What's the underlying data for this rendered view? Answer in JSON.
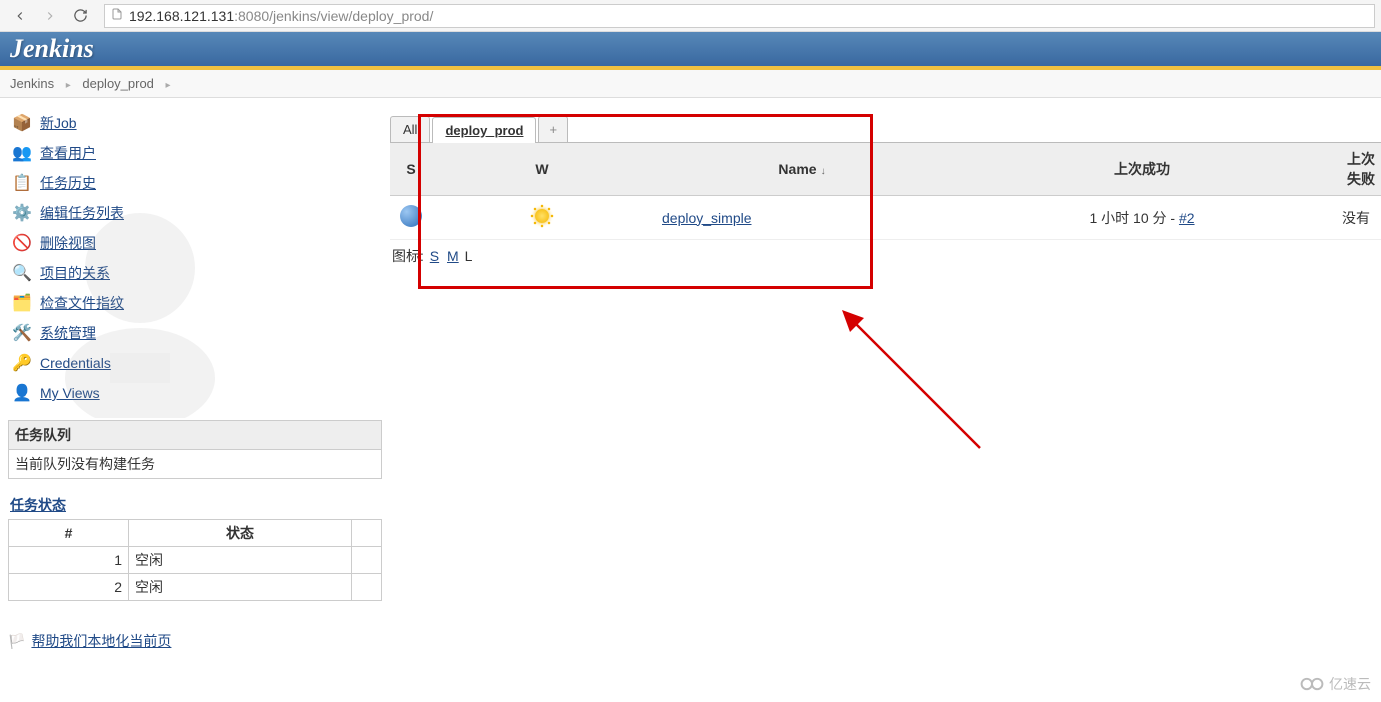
{
  "browser": {
    "url_host": "192.168.121.131",
    "url_port_path": ":8080/jenkins/view/deploy_prod/"
  },
  "header": {
    "logo": "Jenkins"
  },
  "breadcrumb": {
    "root": "Jenkins",
    "view": "deploy_prod"
  },
  "sidebar": {
    "items": [
      {
        "label": "新Job"
      },
      {
        "label": "查看用户"
      },
      {
        "label": "任务历史"
      },
      {
        "label": "编辑任务列表"
      },
      {
        "label": "删除视图"
      },
      {
        "label": "项目的关系"
      },
      {
        "label": "检查文件指纹"
      },
      {
        "label": "系统管理"
      },
      {
        "label": "Credentials"
      },
      {
        "label": "My Views"
      }
    ],
    "queue": {
      "title": "任务队列",
      "empty": "当前队列没有构建任务"
    },
    "status": {
      "title": "任务状态",
      "col_num": "#",
      "col_state": "状态",
      "rows": [
        {
          "n": "1",
          "s": "空闲"
        },
        {
          "n": "2",
          "s": "空闲"
        }
      ]
    },
    "help": "帮助我们本地化当前页"
  },
  "tabs": {
    "all": "All",
    "active": "deploy_prod",
    "plus": "+"
  },
  "table": {
    "cols": {
      "s": "S",
      "w": "W",
      "name": "Name",
      "last_ok": "上次成功",
      "last_fail": "上次失败"
    },
    "rows": [
      {
        "name": "deploy_simple",
        "last_ok_time": "1 小时 10 分 -",
        "last_ok_build": "#2",
        "last_fail": "没有"
      }
    ],
    "icon_label": "图标:",
    "icon_s": "S",
    "icon_m": "M",
    "icon_l": "L"
  },
  "watermark": "亿速云"
}
